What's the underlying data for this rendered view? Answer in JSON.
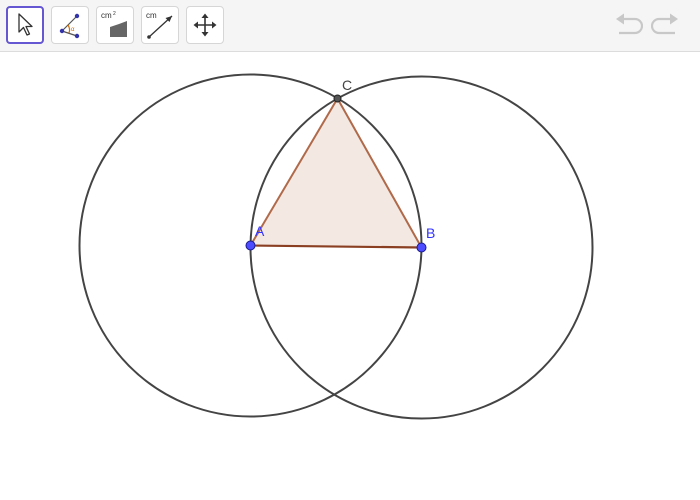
{
  "toolbar": {
    "tools": [
      {
        "id": "move",
        "icon": "cursor-arrow-icon",
        "selected": true
      },
      {
        "id": "angle",
        "icon": "angle-icon",
        "selected": false
      },
      {
        "id": "area",
        "icon": "area-icon",
        "label": "cm²",
        "selected": false
      },
      {
        "id": "distance",
        "icon": "distance-icon",
        "label": "cm",
        "selected": false
      },
      {
        "id": "move-graphics",
        "icon": "move-graphics-icon",
        "selected": false
      }
    ],
    "history": {
      "undo_icon": "undo-icon",
      "redo_icon": "redo-icon",
      "enabled": false
    }
  },
  "construction": {
    "points": {
      "A": {
        "label": "A",
        "color": "#3333ff"
      },
      "B": {
        "label": "B",
        "color": "#3333ff"
      },
      "C": {
        "label": "C",
        "color": "#444444"
      }
    },
    "objects": [
      {
        "type": "circle",
        "center": "A",
        "through": "B"
      },
      {
        "type": "circle",
        "center": "B",
        "through": "A"
      },
      {
        "type": "polygon",
        "vertices": [
          "A",
          "B",
          "C"
        ]
      }
    ]
  },
  "colors": {
    "selection_border": "#6557d2",
    "circle_stroke": "#444444",
    "triangle_stroke": "#b06a4a",
    "triangle_fill": "#f4e8e3",
    "point_free": "#3333ff",
    "point_dependent": "#444444",
    "history_disabled": "#c8c8c8"
  }
}
